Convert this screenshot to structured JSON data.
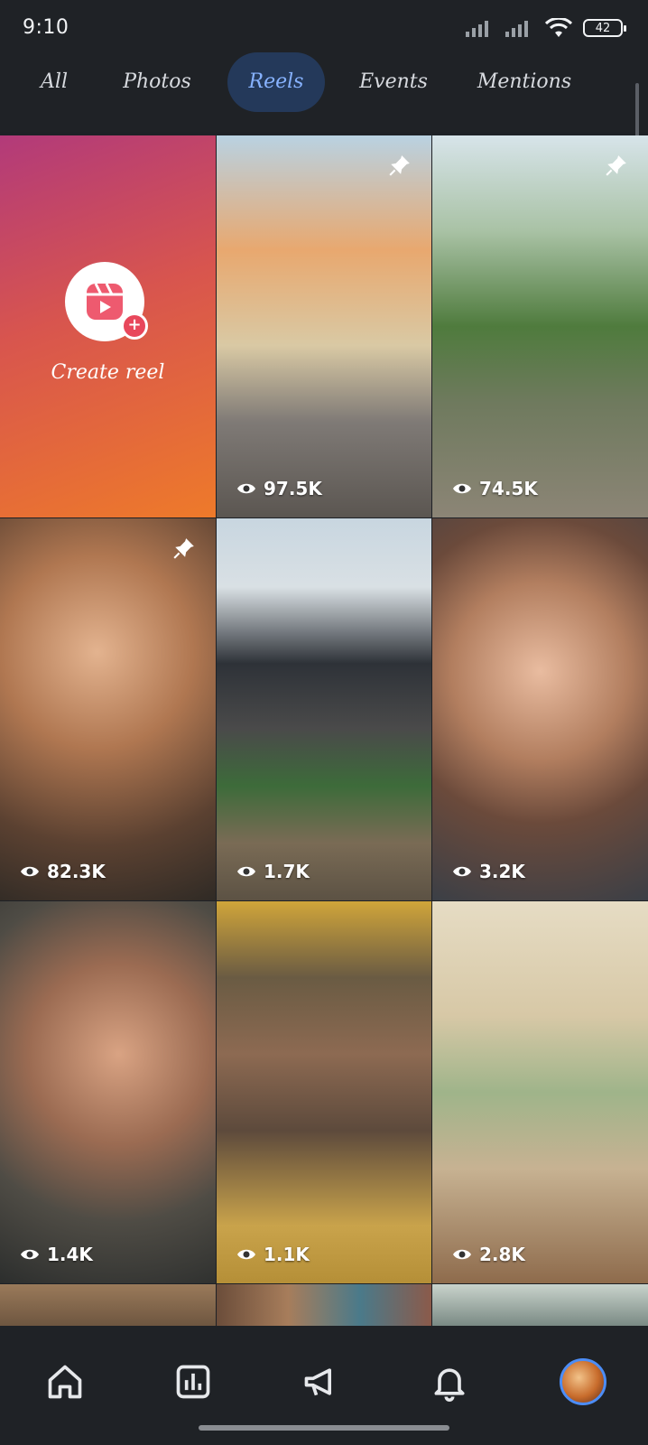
{
  "status": {
    "time": "9:10",
    "battery": "42"
  },
  "tabs": [
    {
      "label": "All"
    },
    {
      "label": "Photos"
    },
    {
      "label": "Reels",
      "active": true
    },
    {
      "label": "Events"
    },
    {
      "label": "Mentions"
    }
  ],
  "create": {
    "label": "Create reel"
  },
  "reels": [
    {
      "views": "97.5K",
      "pinned": true
    },
    {
      "views": "74.5K",
      "pinned": true
    },
    {
      "views": "82.3K",
      "pinned": true
    },
    {
      "views": "1.7K",
      "pinned": false
    },
    {
      "views": "3.2K",
      "pinned": false
    },
    {
      "views": "1.4K",
      "pinned": false
    },
    {
      "views": "1.1K",
      "pinned": false
    },
    {
      "views": "2.8K",
      "pinned": false
    }
  ],
  "nav": {
    "items": [
      "home-icon",
      "insights-icon",
      "megaphone-icon",
      "bell-icon",
      "profile-avatar"
    ]
  },
  "colors": {
    "accent": "#87b2ff",
    "active_tab_bg": "#24395a",
    "background": "#1e2126"
  }
}
